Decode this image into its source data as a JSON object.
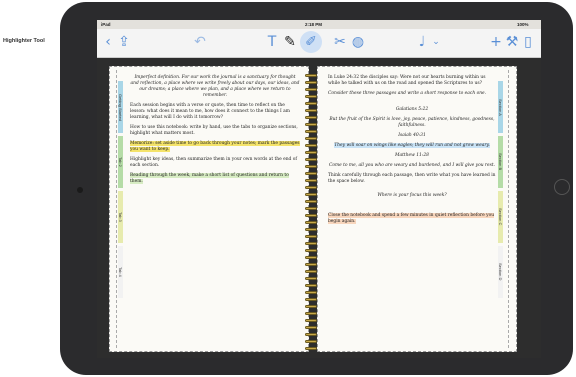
{
  "annotation": {
    "callout_label": "Highlighter Tool"
  },
  "status_bar": {
    "carrier": "iPad",
    "time": "2:18 PM",
    "battery": "100%"
  },
  "toolbar": {
    "back_icon": "chevron-left-icon",
    "share_icon": "share-icon",
    "undo_icon": "undo-icon",
    "text_tool": "T",
    "pen_tool_icon": "pen-icon",
    "highlighter_tool_icon": "highlighter-icon",
    "scissors_icon": "scissors-icon",
    "apple_icon": "apple-icon",
    "mic_icon": "mic-icon",
    "add_icon": "plus-icon",
    "wrench_icon": "wrench-icon",
    "device_icon": "device-icon",
    "accent_color": "#5a8fd6"
  },
  "left_tabs": [
    "Getting Started",
    "Tab 2",
    "Tab 3",
    "Tab 4"
  ],
  "right_tabs": [
    "Section A",
    "Section B",
    "Section C",
    "Section D"
  ],
  "left_page": {
    "paragraphs": [
      "Imperfect definition. For our work the journal is a sanctuary for thought and reflection, a place where we write freely about our days, our ideas, and our dreams; a place where we plan, and a place where we return to remember.",
      "Each session begins with a verse or quote, then time to reflect on the lesson: what does it mean to me, how does it connect to the things I am learning, what will I do with it tomorrow?",
      "How to use this notebook: write by hand, use the tabs to organize sections, highlight what matters most.",
      "Memorize: set aside time to go back through your notes; mark the passages you want to keep.",
      "Highlight key ideas, then summarize them in your own words at the end of each section.",
      "Reading through the week, make a short list of questions and return to them."
    ]
  },
  "right_page": {
    "paragraphs": [
      "In Luke 24:32 the disciples say: Were not our hearts burning within us while he talked with us on the road and opened the Scriptures to us?",
      "Consider these three passages and write a short response to each one.",
      "Galatians 5:22",
      "But the fruit of the Spirit is love, joy, peace, patience, kindness, goodness, faithfulness.",
      "Isaiah 40:31",
      "They will soar on wings like eagles; they will run and not grow weary.",
      "Matthew 11:28",
      "Come to me, all you who are weary and burdened, and I will give you rest.",
      "Think carefully through each passage, then write what you have learned in the space below.",
      "Where is your focus this week?",
      "Close the notebook and spend a few minutes in quiet reflection before you begin again."
    ]
  }
}
